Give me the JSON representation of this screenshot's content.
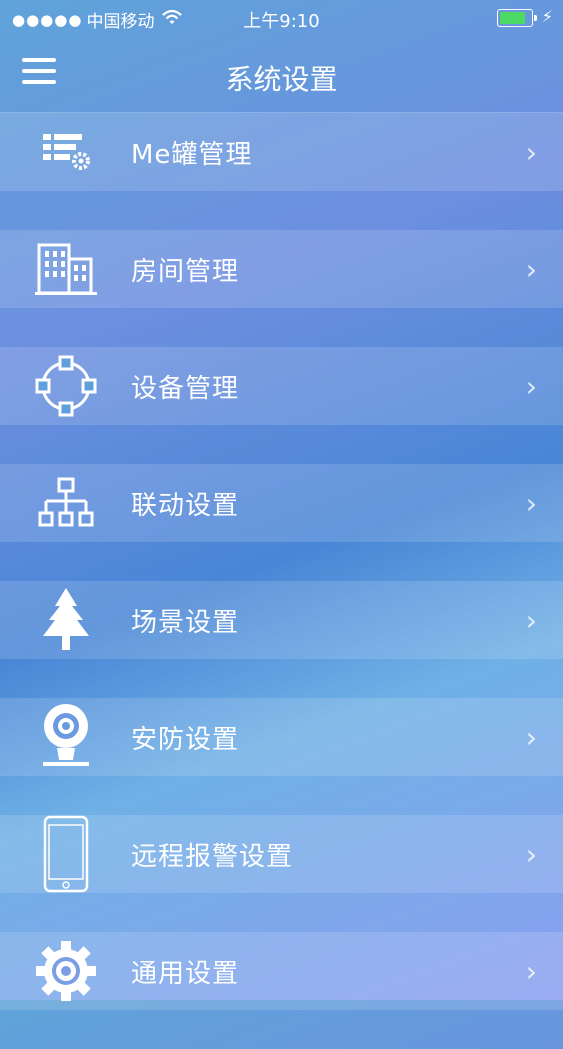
{
  "status_bar": {
    "signal": "●●●●●",
    "carrier": "中国移动",
    "time": "上午9:10",
    "battery_color": "#4cd964"
  },
  "nav": {
    "title": "系统设置",
    "menu_icon": "hamburger-icon"
  },
  "menu_items": [
    {
      "label": "Me罐管理",
      "icon": "list-settings-icon"
    },
    {
      "label": "房间管理",
      "icon": "building-icon"
    },
    {
      "label": "设备管理",
      "icon": "device-network-icon"
    },
    {
      "label": "联动设置",
      "icon": "hierarchy-icon"
    },
    {
      "label": "场景设置",
      "icon": "tree-icon"
    },
    {
      "label": "安防设置",
      "icon": "camera-icon"
    },
    {
      "label": "远程报警设置",
      "icon": "phone-icon"
    },
    {
      "label": "通用设置",
      "icon": "gear-icon"
    }
  ],
  "chevron": "›"
}
